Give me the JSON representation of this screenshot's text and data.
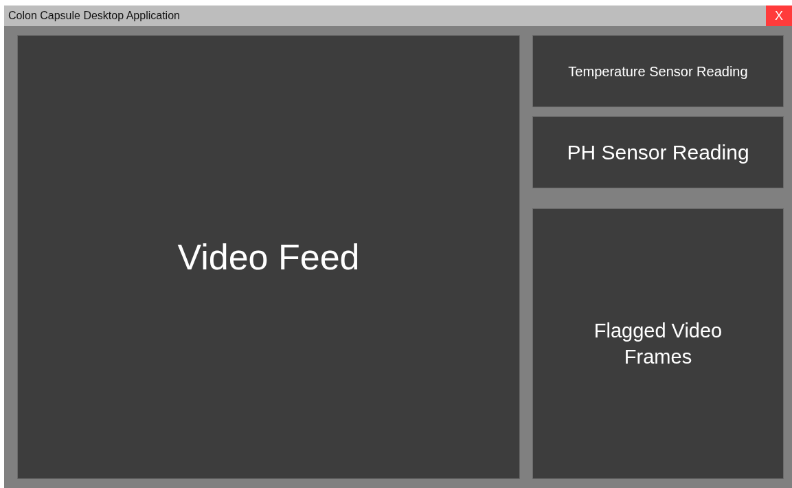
{
  "window": {
    "title": "Colon Capsule Desktop Application",
    "close": "X"
  },
  "video_feed": {
    "label": "Video Feed"
  },
  "panels": [
    {
      "kind": "small",
      "label": "Temperature Sensor Reading"
    },
    {
      "kind": "medium",
      "label": "PH Sensor Reading"
    },
    {
      "kind": "large",
      "label": "Flagged Video Frames"
    }
  ]
}
